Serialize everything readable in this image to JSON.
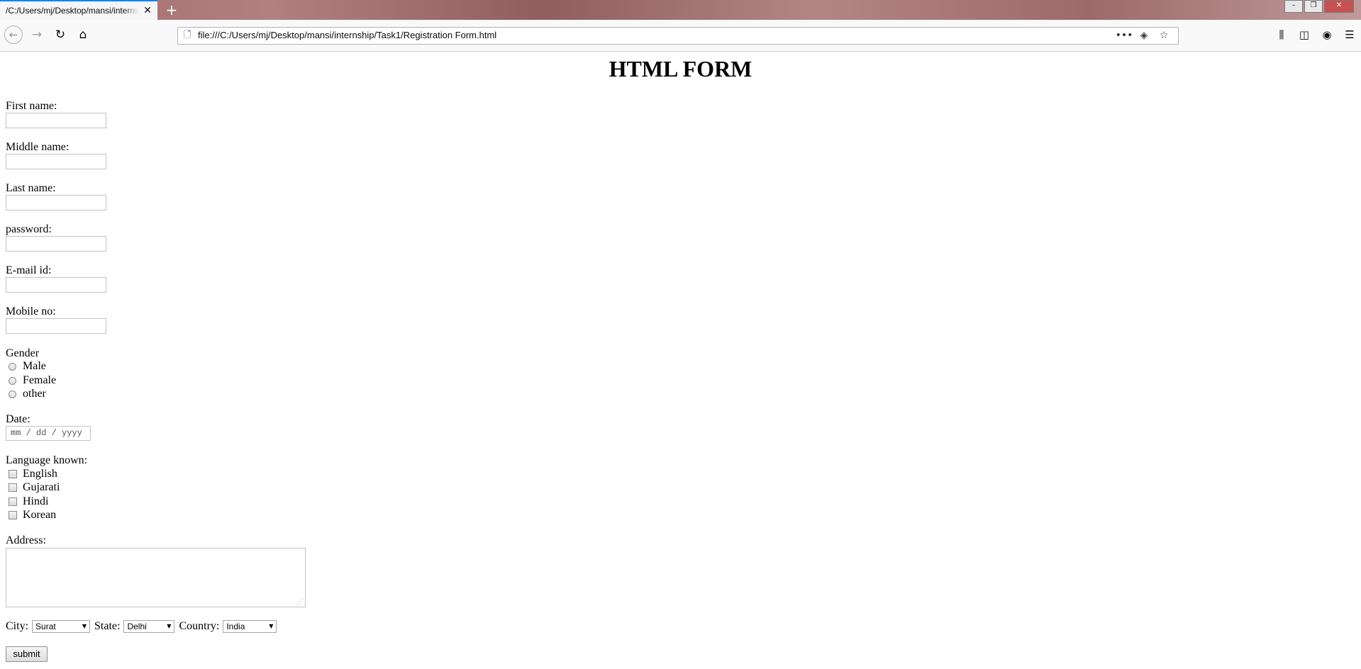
{
  "browser": {
    "tab_title": "/C:/Users/mj/Desktop/mansi/internship/Task1/Registration Form.html",
    "tab_close_glyph": "✕",
    "new_tab_glyph": "+",
    "address_url": "file:///C:/Users/mj/Desktop/mansi/internship/Task1/Registration Form.html",
    "page_actions_glyph": "•••",
    "window_controls": {
      "minimize": "–",
      "maximize": "❐",
      "close": "✕"
    }
  },
  "page": {
    "title": "HTML FORM",
    "fields": {
      "first_name": {
        "label": "First name:",
        "value": ""
      },
      "middle_name": {
        "label": "Middle name:",
        "value": ""
      },
      "last_name": {
        "label": "Last name:",
        "value": ""
      },
      "password": {
        "label": "password:",
        "value": ""
      },
      "email": {
        "label": "E-mail id:",
        "value": ""
      },
      "mobile": {
        "label": "Mobile no:",
        "value": ""
      }
    },
    "gender": {
      "label": "Gender",
      "options": [
        "Male",
        "Female",
        "other"
      ]
    },
    "date": {
      "label": "Date:",
      "placeholder": "mm / dd / yyyy"
    },
    "languages": {
      "label": "Language known:",
      "options": [
        "English",
        "Gujarati",
        "Hindi",
        "Korean"
      ]
    },
    "address": {
      "label": "Address:",
      "value": ""
    },
    "city": {
      "label": "City:",
      "selected": "Surat"
    },
    "state": {
      "label": "State:",
      "selected": "Delhi"
    },
    "country": {
      "label": "Country:",
      "selected": "India"
    },
    "submit_label": "submit"
  },
  "icons": {
    "back": "back-arrow-icon",
    "forward": "forward-arrow-icon",
    "reload": "reload-icon",
    "home": "home-icon",
    "page": "page-icon",
    "pocket": "pocket-icon",
    "bookmark": "star-icon",
    "library": "library-icon",
    "sidebar": "sidebar-icon",
    "account": "account-icon",
    "menu": "hamburger-menu-icon"
  }
}
